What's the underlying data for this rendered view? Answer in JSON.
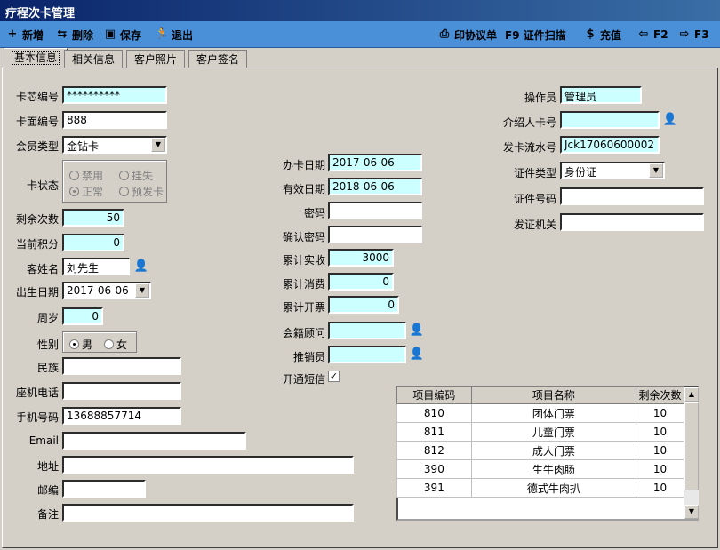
{
  "window": {
    "title": "疗程次卡管理"
  },
  "toolbar": {
    "add": "新增",
    "delete": "删除",
    "save": "保存",
    "exit": "退出",
    "print": "印协议单",
    "scan": "F9 证件扫描",
    "recharge": "充值",
    "prev": "F2",
    "next": "F3"
  },
  "tabs": [
    "基本信息",
    "相关信息",
    "客户照片",
    "客户签名"
  ],
  "form": {
    "chip_no": {
      "label": "卡芯编号",
      "value": "**********"
    },
    "face_no": {
      "label": "卡面编号",
      "value": "888"
    },
    "member_type": {
      "label": "会员类型",
      "value": "金钻卡"
    },
    "card_status": {
      "label": "卡状态",
      "options": [
        "禁用",
        "挂失",
        "正常",
        "预发卡"
      ],
      "selected": "正常"
    },
    "remaining": {
      "label": "剩余次数",
      "value": "50"
    },
    "points": {
      "label": "当前积分",
      "value": "0"
    },
    "name": {
      "label": "客姓名",
      "value": "刘先生"
    },
    "birth": {
      "label": "出生日期",
      "value": "2017-06-06"
    },
    "age": {
      "label": "周岁",
      "value": "0"
    },
    "gender": {
      "label": "性别",
      "male": "男",
      "female": "女",
      "selected": "男"
    },
    "ethnic": {
      "label": "民族",
      "value": ""
    },
    "landline": {
      "label": "座机电话",
      "value": ""
    },
    "mobile": {
      "label": "手机号码",
      "value": "13688857714"
    },
    "email": {
      "label": "Email",
      "value": ""
    },
    "address": {
      "label": "地址",
      "value": ""
    },
    "zip": {
      "label": "邮编",
      "value": ""
    },
    "note": {
      "label": "备注",
      "value": ""
    },
    "issue_date": {
      "label": "办卡日期",
      "value": "2017-06-06"
    },
    "valid_date": {
      "label": "有效日期",
      "value": "2018-06-06"
    },
    "password": {
      "label": "密码",
      "value": ""
    },
    "confirm_password": {
      "label": "确认密码",
      "value": ""
    },
    "total_paid": {
      "label": "累计实收",
      "value": "3000"
    },
    "total_spent": {
      "label": "累计消费",
      "value": "0"
    },
    "total_invoiced": {
      "label": "累计开票",
      "value": "0"
    },
    "advisor": {
      "label": "会籍顾问",
      "value": ""
    },
    "promoter": {
      "label": "推销员",
      "value": ""
    },
    "sms": {
      "label": "开通短信",
      "checked": true
    },
    "operator": {
      "label": "操作员",
      "value": "管理员"
    },
    "referrer": {
      "label": "介绍人卡号",
      "value": ""
    },
    "serial": {
      "label": "发卡流水号",
      "value": "Jck17060600002"
    },
    "id_type": {
      "label": "证件类型",
      "value": "身份证"
    },
    "id_no": {
      "label": "证件号码",
      "value": ""
    },
    "id_issuer": {
      "label": "发证机关",
      "value": ""
    }
  },
  "grid": {
    "headers": [
      "项目编码",
      "项目名称",
      "剩余次数"
    ],
    "rows": [
      [
        "810",
        "团体门票",
        "10"
      ],
      [
        "811",
        "儿童门票",
        "10"
      ],
      [
        "812",
        "成人门票",
        "10"
      ],
      [
        "390",
        "生牛肉肠",
        "10"
      ],
      [
        "391",
        "德式牛肉扒",
        "10"
      ]
    ]
  }
}
